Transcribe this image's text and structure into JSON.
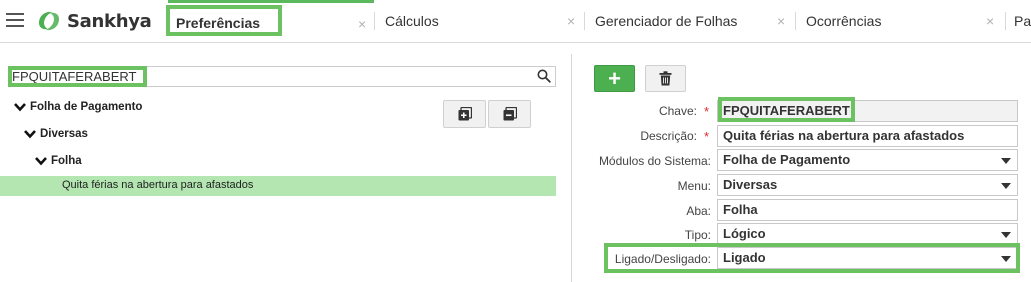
{
  "app": {
    "brand": "Sankhya",
    "accent": "#5cb85c",
    "highlight": "#6cc260"
  },
  "tabs": [
    {
      "label": "Preferências",
      "active": true
    },
    {
      "label": "Cálculos",
      "active": false
    },
    {
      "label": "Gerenciador de Folhas",
      "active": false
    },
    {
      "label": "Ocorrências",
      "active": false
    },
    {
      "label": "Pa",
      "active": false
    }
  ],
  "tab_close_glyph": "×",
  "left": {
    "search_value": "FPQUITAFERABERT",
    "tree": [
      {
        "label": "Folha de Pagamento",
        "level": 0
      },
      {
        "label": "Diversas",
        "level": 1
      },
      {
        "label": "Folha",
        "level": 2
      }
    ],
    "selected_item": "Quita férias na abertura para afastados",
    "selected_color": "#b3e6b1"
  },
  "form": {
    "add_label": "+",
    "fields": {
      "chave": {
        "label": "Chave:",
        "value": "FPQUITAFERABERT",
        "required": true
      },
      "descricao": {
        "label": "Descrição:",
        "value": "Quita férias na abertura para afastados",
        "required": true
      },
      "modulos": {
        "label": "Módulos do Sistema:",
        "value": "Folha de Pagamento"
      },
      "menu": {
        "label": "Menu:",
        "value": "Diversas"
      },
      "aba": {
        "label": "Aba:",
        "value": "Folha"
      },
      "tipo": {
        "label": "Tipo:",
        "value": "Lógico"
      },
      "ligado": {
        "label": "Ligado/Desligado:",
        "value": "Ligado"
      }
    },
    "required_mark": "*"
  }
}
